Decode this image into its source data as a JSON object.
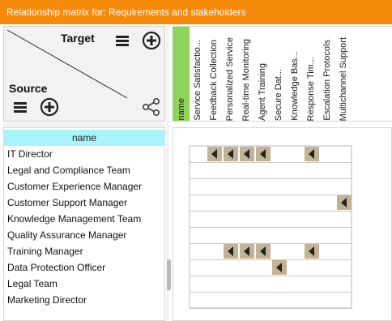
{
  "window": {
    "title": "Relationship matrix for: Requirements and stakeholders"
  },
  "corner": {
    "target_label": "Target",
    "source_label": "Source",
    "icons": [
      "menu-icon",
      "add-circle-icon",
      "share-icon"
    ]
  },
  "columns": {
    "name_header": "name",
    "items": [
      "Service Satisfactio...",
      "Feedback Collection",
      "Personalized Service",
      "Real-time Monitoring",
      "Agent Training",
      "Secure Dat...",
      "Knowledge Bas...",
      "Response Tim...",
      "Escalation Protocols",
      "Multichannel Support"
    ]
  },
  "rows": {
    "name_header": "name",
    "items": [
      "IT Director",
      "Legal and Compliance Team",
      "Customer Experience Manager",
      "Customer Support Manager",
      "Knowledge Management Team",
      "Quality Assurance Manager",
      "Training Manager",
      "Data Protection Officer",
      "Legal Team",
      "Marketing Director"
    ]
  },
  "relations": [
    {
      "row": 0,
      "col": 1
    },
    {
      "row": 0,
      "col": 2
    },
    {
      "row": 0,
      "col": 3
    },
    {
      "row": 0,
      "col": 4
    },
    {
      "row": 0,
      "col": 7
    },
    {
      "row": 3,
      "col": 9
    },
    {
      "row": 6,
      "col": 2
    },
    {
      "row": 6,
      "col": 3
    },
    {
      "row": 6,
      "col": 4
    },
    {
      "row": 6,
      "col": 7
    },
    {
      "row": 7,
      "col": 5
    }
  ],
  "colors": {
    "titlebar": "#f58a0b",
    "row_header": "#a9f4fa",
    "column_name_band": "#8fd35b",
    "relation_cell": "#c3b394",
    "relation_arrow": "#222222"
  }
}
